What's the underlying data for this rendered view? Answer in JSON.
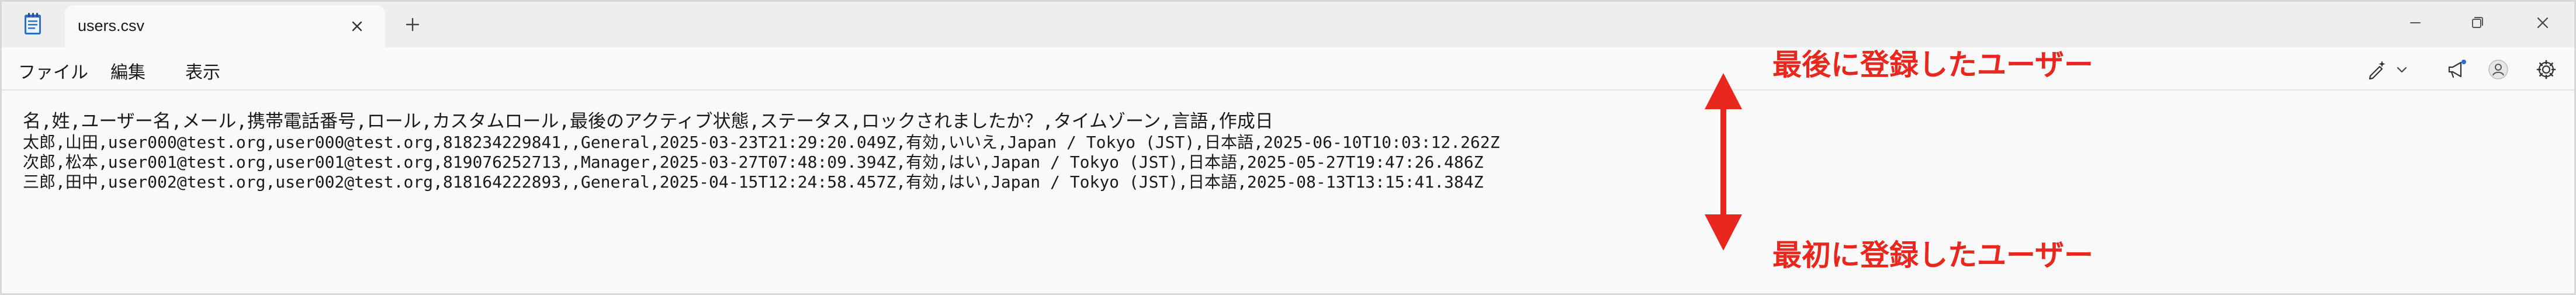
{
  "tab": {
    "title": "users.csv"
  },
  "menu": {
    "file": "ファイル",
    "edit": "編集",
    "view": "表示"
  },
  "icons": {
    "app": "notepad-icon",
    "close_tab": "close-icon",
    "new_tab": "plus-icon",
    "minimize": "minimize-icon",
    "maximize": "maximize-icon",
    "close_window": "close-icon",
    "copilot": "copilot-pen-icon",
    "dropdown": "chevron-down-icon",
    "notify": "megaphone-icon",
    "account": "avatar-icon",
    "settings": "gear-icon"
  },
  "editor": {
    "lines": [
      "名,姓,ユーザー名,メール,携帯電話番号,ロール,カスタムロール,最後のアクティブ状態,ステータス,ロックされましたか？,タイムゾーン,言語,作成日",
      "太郎,山田,user000@test.org,user000@test.org,818234229841,,General,2025-03-23T21:29:20.049Z,有効,いいえ,Japan / Tokyo (JST),日本語,2025-06-10T10:03:12.262Z",
      "次郎,松本,user001@test.org,user001@test.org,819076252713,,Manager,2025-03-27T07:48:09.394Z,有効,はい,Japan / Tokyo (JST),日本語,2025-05-27T19:47:26.486Z",
      "三郎,田中,user002@test.org,user002@test.org,818164222893,,General,2025-04-15T12:24:58.457Z,有効,はい,Japan / Tokyo (JST),日本語,2025-08-13T13:15:41.384Z"
    ]
  },
  "annotations": {
    "top": "最後に登録したユーザー",
    "bottom": "最初に登録したユーザー",
    "color": "#e8271f"
  },
  "colors": {
    "tabbar_bg": "#eeeeee",
    "window_bg": "#f9f9f9",
    "text": "#1a1a1a",
    "accent_red": "#e8271f"
  }
}
